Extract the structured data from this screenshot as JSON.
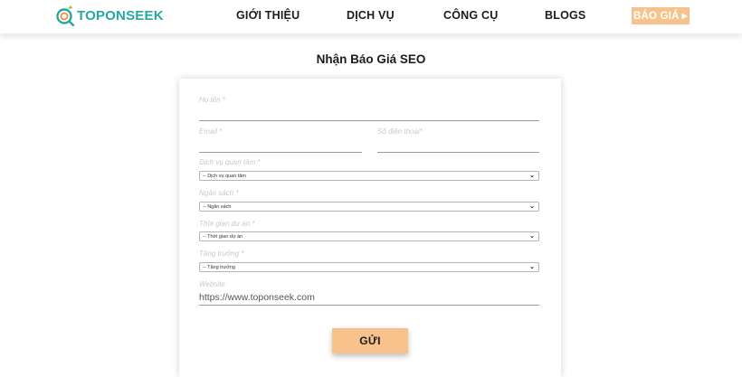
{
  "brand": {
    "logo_top": "TOPON",
    "logo_seek": "SEEK"
  },
  "nav": {
    "items": [
      "GIỚI THIỆU",
      "DỊCH VỤ",
      "CÔNG CỤ",
      "BLOGS"
    ],
    "quote_button": "BÁO GIÁ"
  },
  "page": {
    "title": "Nhận Báo Giá SEO"
  },
  "form": {
    "name_label": "Họ tên *",
    "email_label": "Email *",
    "phone_label": "Số điện thoại*",
    "service": {
      "label": "Dịch vụ quan tâm *",
      "selected": "-- Dịch vụ quan tâm"
    },
    "budget": {
      "label": "Ngân sách *",
      "selected": "-- Ngân sách"
    },
    "timeline": {
      "label": "Thời gian dự án *",
      "selected": "-- Thời gian dự án"
    },
    "growth": {
      "label": "Tăng trưởng *",
      "selected": "-- Tăng trưởng"
    },
    "website": {
      "label": "Website",
      "value": "https://www.toponseek.com"
    },
    "submit_label": "GỬI"
  },
  "colors": {
    "accent": "#f7c28c",
    "brand": "#26a8a2"
  },
  "icons": {
    "logo": "magnifier-logo-icon",
    "dropdown": "chevron-down-icon",
    "quote_arrow": "triangle-right-icon"
  }
}
